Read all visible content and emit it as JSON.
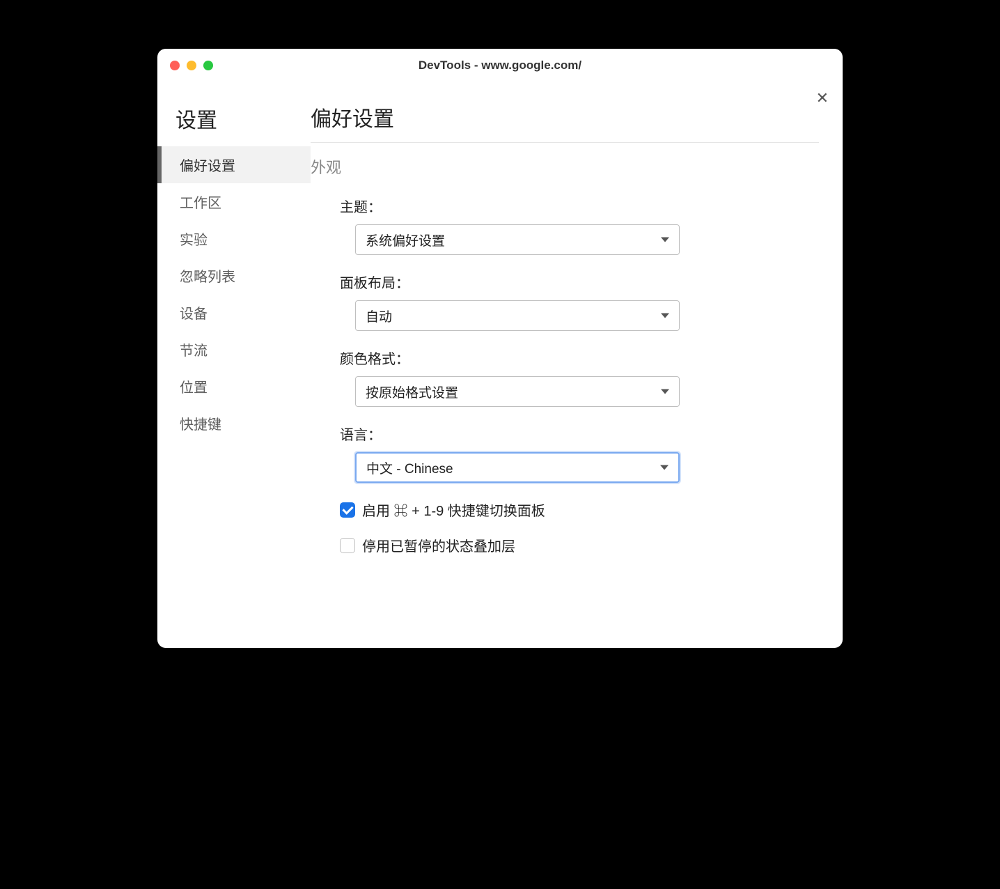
{
  "window": {
    "title": "DevTools - www.google.com/"
  },
  "sidebar": {
    "title": "设置",
    "items": [
      {
        "label": "偏好设置",
        "active": true
      },
      {
        "label": "工作区",
        "active": false
      },
      {
        "label": "实验",
        "active": false
      },
      {
        "label": "忽略列表",
        "active": false
      },
      {
        "label": "设备",
        "active": false
      },
      {
        "label": "节流",
        "active": false
      },
      {
        "label": "位置",
        "active": false
      },
      {
        "label": "快捷键",
        "active": false
      }
    ]
  },
  "main": {
    "title": "偏好设置",
    "section_appearance": "外观",
    "fields": {
      "theme": {
        "label": "主题：",
        "value": "系统偏好设置"
      },
      "panel_layout": {
        "label": "面板布局：",
        "value": "自动"
      },
      "color_format": {
        "label": "颜色格式：",
        "value": "按原始格式设置"
      },
      "language": {
        "label": "语言：",
        "value": "中文 - Chinese",
        "focused": true
      }
    },
    "checkboxes": {
      "enable_shortcut": {
        "label": "启用 ⌘ + 1-9 快捷键切换面板",
        "checked": true
      },
      "disable_overlay": {
        "label": "停用已暂停的状态叠加层",
        "checked": false
      }
    }
  }
}
